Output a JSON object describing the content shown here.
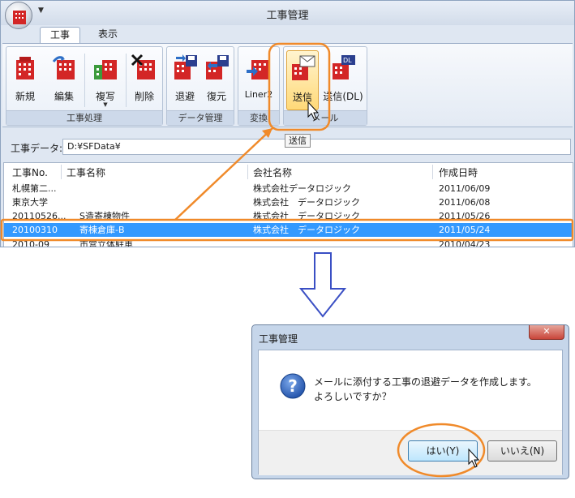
{
  "window": {
    "title": "工事管理"
  },
  "tabs": [
    {
      "label": "工事",
      "active": true
    },
    {
      "label": "表示",
      "active": false
    }
  ],
  "ribbon": {
    "groups": [
      {
        "label": "工事処理",
        "buttons": [
          "新規",
          "編集",
          "複写",
          "削除"
        ]
      },
      {
        "label": "データ管理",
        "buttons": [
          "退避",
          "復元"
        ]
      },
      {
        "label": "変換",
        "buttons": [
          "Liner2"
        ]
      },
      {
        "label": "メール",
        "buttons": [
          "送信",
          "送信(DL)"
        ]
      }
    ]
  },
  "tooltip": "送信",
  "data_path": {
    "label": "工事データ:",
    "value": "D:¥SFData¥"
  },
  "list": {
    "columns": [
      "工事No.",
      "工事名称",
      "会社名称",
      "作成日時"
    ],
    "rows": [
      {
        "no": "札幌第二...",
        "name": "",
        "company": "株式会社データロジック",
        "date": "2011/06/09",
        "selected": false
      },
      {
        "no": "東京大学",
        "name": "",
        "company": "株式会社　データロジック",
        "date": "2011/06/08",
        "selected": false
      },
      {
        "no": "20110526...",
        "name": "S造寄棟物件",
        "company": "株式会社　データロジック",
        "date": "2011/05/26",
        "selected": false
      },
      {
        "no": "20100310",
        "name": "寄棟倉庫-B",
        "company": "株式会社　データロジック",
        "date": "2011/05/24",
        "selected": true
      },
      {
        "no": "2010-09",
        "name": "市営立体駐車",
        "company": "",
        "date": "2010/04/23",
        "selected": false
      }
    ]
  },
  "dialog": {
    "title": "工事管理",
    "message_line1": "メールに添付する工事の退避データを作成します。",
    "message_line2": "よろしいですか？",
    "yes_label": "はい(Y)",
    "no_label": "いいえ(N)",
    "icon": "question-icon"
  },
  "colors": {
    "highlight_orange": "#f08a2a",
    "selection_blue": "#3399ff",
    "down_arrow_blue": "#3a4fc4"
  }
}
